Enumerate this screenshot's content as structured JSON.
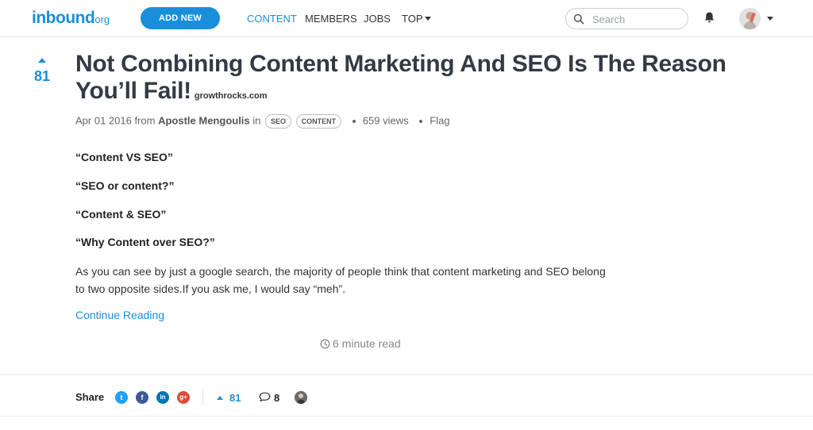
{
  "header": {
    "logo_main": "inbound",
    "logo_suffix": "org",
    "add_new_label": "ADD NEW",
    "nav": {
      "content": "CONTENT",
      "members": "MEMBERS",
      "jobs": "JOBS",
      "top": "TOP"
    },
    "search_placeholder": "Search",
    "icons": {
      "search": "search-icon",
      "bell": "bell-icon",
      "caret": "caret-down-icon"
    }
  },
  "post": {
    "votes": "81",
    "title": "Not Combining Content Marketing And SEO Is The Reason You’ll Fail!",
    "domain": "growthrocks.com",
    "date": "Apr 01 2016",
    "from_label": "from",
    "author": "Apostle Mengoulis",
    "in_label": "in",
    "tags": [
      "SEO",
      "CONTENT"
    ],
    "views": "659 views",
    "flag": "Flag",
    "quotes": [
      "“Content VS SEO”",
      "“SEO or content?”",
      "“Content & SEO”",
      "“Why Content over SEO?”"
    ],
    "paragraph_line1": "As you can see by just a  google search, the majority of people think that content marketing and SEO belong",
    "paragraph_line2": "to two opposite sides.If you ask me, I would say “meh”.",
    "continue_label": "Continue Reading",
    "read_time": "6 minute read"
  },
  "share": {
    "label": "Share",
    "networks": [
      {
        "name": "twitter",
        "glyph": "t",
        "color": "#1da1f2"
      },
      {
        "name": "facebook",
        "glyph": "f",
        "color": "#3b5998"
      },
      {
        "name": "linkedin",
        "glyph": "in",
        "color": "#0077b5"
      },
      {
        "name": "google-plus",
        "glyph": "g+",
        "color": "#dd4b39"
      }
    ],
    "votes": "81",
    "comments": "8"
  },
  "colors": {
    "accent": "#1a8fd9",
    "title": "#333a44",
    "muted": "#888888"
  }
}
